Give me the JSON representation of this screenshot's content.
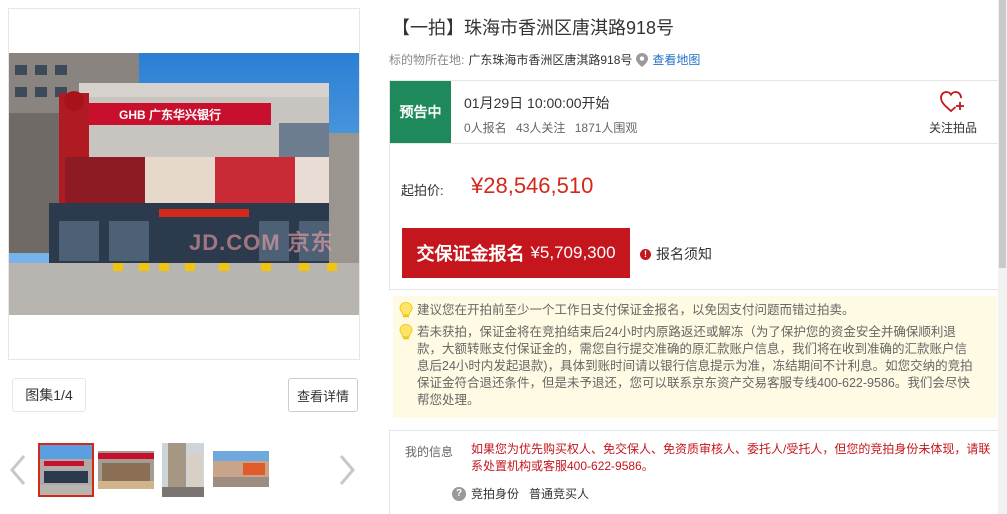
{
  "gallery": {
    "sign_text": "GHB 广东华兴银行",
    "watermark": "JD.COM 京东",
    "album_label": "图集1/4",
    "detail_label": "查看详情"
  },
  "auction": {
    "title": "【一拍】珠海市香洲区唐淇路918号",
    "location_label": "标的物所在地:",
    "location_address": "广东珠海市香洲区唐淇路918号",
    "map_link": "查看地图",
    "status_badge": "预告中",
    "start_time": "01月29日 10:00:00开始",
    "signup_count": "0人报名",
    "follow_count": "43人关注",
    "watch_count": "1871人围观",
    "follow_label": "关注拍品",
    "start_price_label": "起拍价:",
    "start_price": "¥28,546,510",
    "deposit_label": "交保证金报名",
    "deposit_amount": "¥5,709,300",
    "notice_label": "报名须知",
    "notice_icon_text": "!"
  },
  "tips": [
    "建议您在开拍前至少一个工作日支付保证金报名，以免因支付问题而错过拍卖。",
    "若未获拍，保证金将在竞拍结束后24小时内原路返还或解冻（为了保护您的资金安全并确保顺利退款，大额转账支付保证金的，需您自行提交准确的原汇款账户信息，我们将在收到准确的汇款账户信息后24小时内发起退款)，具体到账时间请以银行信息提示为准，冻结期间不计利息。如您交纳的竞拍保证金符合退还条件，但是未予退还，您可以联系京东资产交易客服专线400-622-9586。我们会尽快帮您处理。"
  ],
  "my_info": {
    "label": "我的信息",
    "warning": "如果您为优先购买权人、免交保人、免资质审核人、委托人/受托人，但您的竞拍身份未体现，请联系处置机构或客服400-622-9586。",
    "identity_label": "竞拍身份",
    "identity_value": "普通竞买人",
    "help_icon_text": "?"
  },
  "colors": {
    "brand_red": "#c4161c",
    "status_green": "#1e8a5c",
    "link_blue": "#1d6fc9",
    "tip_bg": "#fffae3"
  },
  "icons": [
    "location-pin-icon",
    "heart-plus-icon",
    "warning-icon",
    "lightbulb-icon",
    "help-icon",
    "chevron-left-icon",
    "chevron-right-icon"
  ]
}
